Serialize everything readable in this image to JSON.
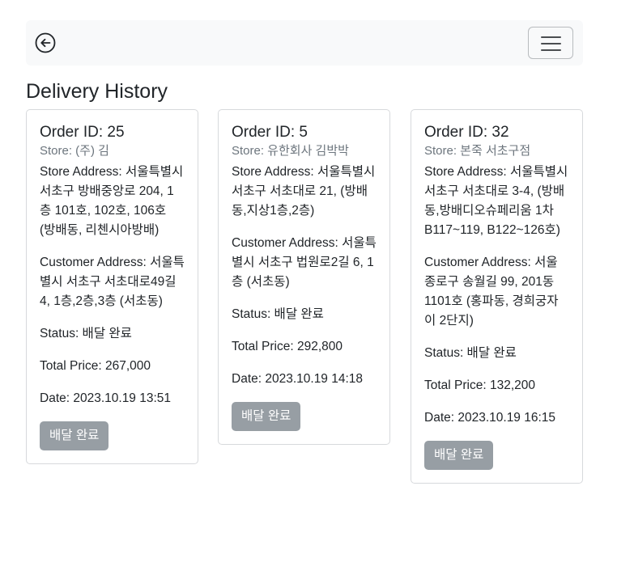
{
  "header": {
    "back_icon": "circle-arrow-left-icon",
    "menu_icon": "hamburger-menu-icon"
  },
  "page": {
    "title": "Delivery History"
  },
  "orders": [
    {
      "order_id": "Order ID: 25",
      "store": "Store: (주) 김",
      "store_address": "Store Address: 서울특별시 서초구 방배중앙로 204, 1층 101호, 102호, 106호 (방배동, 리첸시아방배)",
      "customer_address": "Customer Address: 서울특별시 서초구 서초대로49길 4, 1층,2층,3층 (서초동)",
      "status": "Status: 배달 완료",
      "total_price": "Total Price: 267,000",
      "date": "Date: 2023.10.19 13:51",
      "button_label": "배달 완료"
    },
    {
      "order_id": "Order ID: 5",
      "store": "Store: 유한회사 김박박",
      "store_address": "Store Address: 서울특별시 서초구 서초대로 21, (방배동,지상1층,2층)",
      "customer_address": "Customer Address: 서울특별시 서초구 법원로2길 6, 1층 (서초동)",
      "status": "Status: 배달 완료",
      "total_price": "Total Price: 292,800",
      "date": "Date: 2023.10.19 14:18",
      "button_label": "배달 완료"
    },
    {
      "order_id": "Order ID: 32",
      "store": "Store: 본죽 서초구점",
      "store_address": "Store Address: 서울특별시 서초구 서초대로 3-4, (방배동,방배디오슈페리움 1차 B117~119, B122~126호)",
      "customer_address": "Customer Address: 서울 종로구 송월길 99, 201동 1101호 (홍파동, 경희궁자이 2단지)",
      "status": "Status: 배달 완료",
      "total_price": "Total Price: 132,200",
      "date": "Date: 2023.10.19 16:15",
      "button_label": "배달 완료"
    }
  ]
}
